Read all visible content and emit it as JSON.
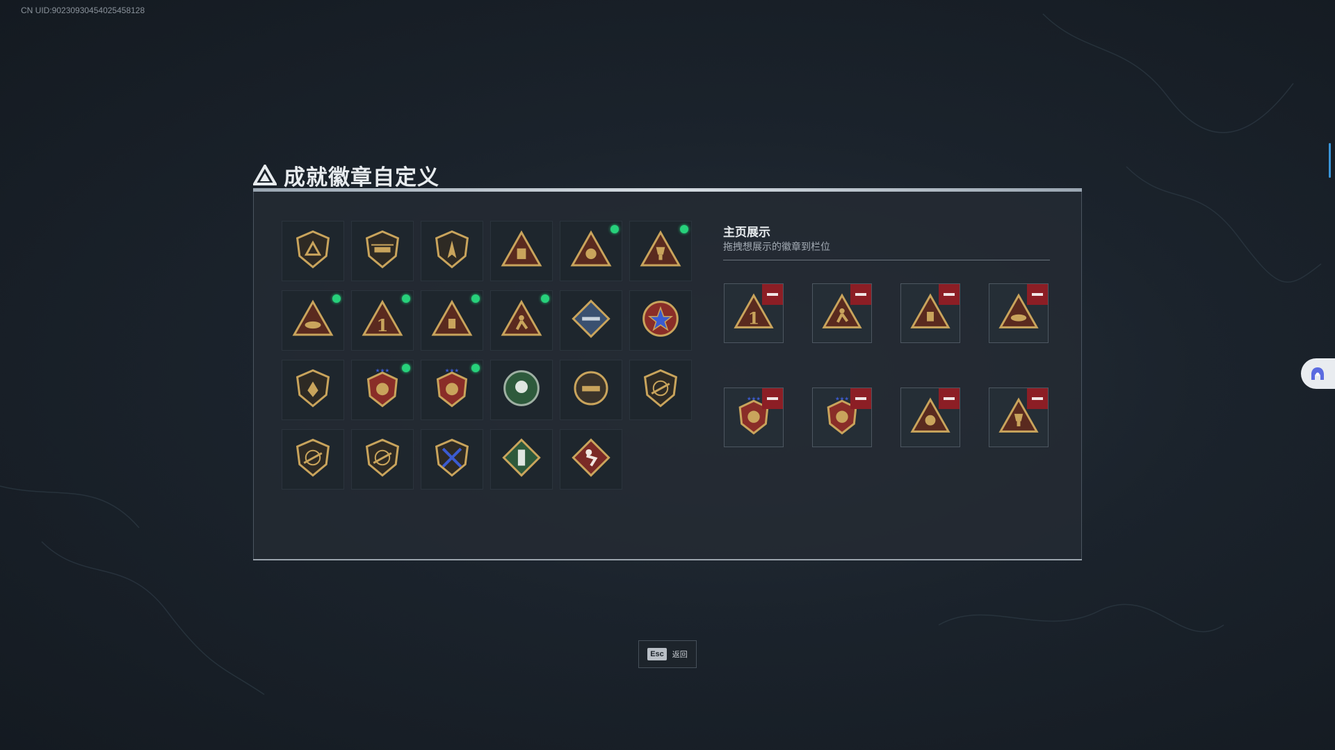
{
  "uid": "CN UID:902309304540254581​28",
  "header": {
    "title": "成就徽章自定义",
    "icon": "triangle-logo-icon"
  },
  "badges": [
    {
      "icon": "shield-triangle-badge",
      "new": false
    },
    {
      "icon": "helicopter-shield-badge",
      "new": false
    },
    {
      "icon": "aircraft-shield-badge",
      "new": false
    },
    {
      "icon": "triangle-backpack-badge",
      "new": false
    },
    {
      "icon": "triangle-medal-badge",
      "new": true
    },
    {
      "icon": "triangle-trophy-badge",
      "new": true
    },
    {
      "icon": "triangle-hands-badge",
      "new": true
    },
    {
      "icon": "triangle-number-one-badge",
      "new": true
    },
    {
      "icon": "triangle-bottle-badge",
      "new": true
    },
    {
      "icon": "triangle-runner-badge",
      "new": true
    },
    {
      "icon": "diamond-rocket-badge",
      "new": false
    },
    {
      "icon": "star-wreath-badge",
      "new": false
    },
    {
      "icon": "shield-emblem-badge",
      "new": false
    },
    {
      "icon": "crest-stars-badge-a",
      "new": true
    },
    {
      "icon": "crest-stars-badge-b",
      "new": true
    },
    {
      "icon": "green-skull-badge",
      "new": false
    },
    {
      "icon": "tank-burst-badge",
      "new": false
    },
    {
      "icon": "rifle-shield-badge-a",
      "new": false
    },
    {
      "icon": "rifle-shield-badge-b",
      "new": false
    },
    {
      "icon": "rifle-shield-badge-c",
      "new": false
    },
    {
      "icon": "crossed-rifles-badge",
      "new": false
    },
    {
      "icon": "green-grenade-badge",
      "new": false
    },
    {
      "icon": "red-soldier-badge",
      "new": false
    }
  ],
  "showcase": {
    "title": "主页展示",
    "subtitle": "拖拽想展示的徽章到栏位",
    "slots": [
      {
        "icon": "triangle-number-one-badge"
      },
      {
        "icon": "triangle-runner-badge"
      },
      {
        "icon": "triangle-bottle-badge"
      },
      {
        "icon": "triangle-hands-badge"
      },
      {
        "icon": "crest-stars-badge-b"
      },
      {
        "icon": "crest-stars-badge-a"
      },
      {
        "icon": "triangle-medal-badge"
      },
      {
        "icon": "triangle-trophy-badge"
      }
    ]
  },
  "footer": {
    "esc_key": "Esc",
    "esc_label": "返回"
  },
  "colors": {
    "new_dot": "#27d17b",
    "remove": "#8c1e25",
    "gold": "#c9a45c",
    "accent_blue": "#3a95d8"
  }
}
